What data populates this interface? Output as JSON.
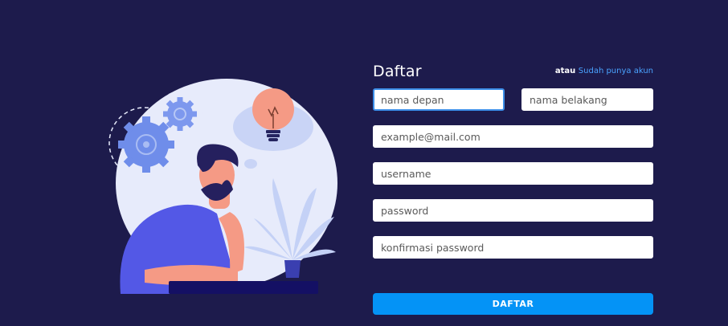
{
  "form": {
    "title": "Daftar",
    "login_prefix": "atau",
    "login_link": "Sudah punya akun",
    "fields": {
      "first_name": "nama depan",
      "last_name": "nama belakang",
      "email": "example@mail.com",
      "username": "username",
      "password": "password",
      "confirm_password": "konfirmasi password"
    },
    "submit_label": "DAFTAR"
  },
  "colors": {
    "background": "#1d1b4c",
    "accent": "#0493f6",
    "link": "#4aa3ff"
  },
  "illustration": {
    "icons": [
      "thinking-person",
      "lightbulb-icon",
      "gear-icon",
      "plant-icon"
    ]
  }
}
